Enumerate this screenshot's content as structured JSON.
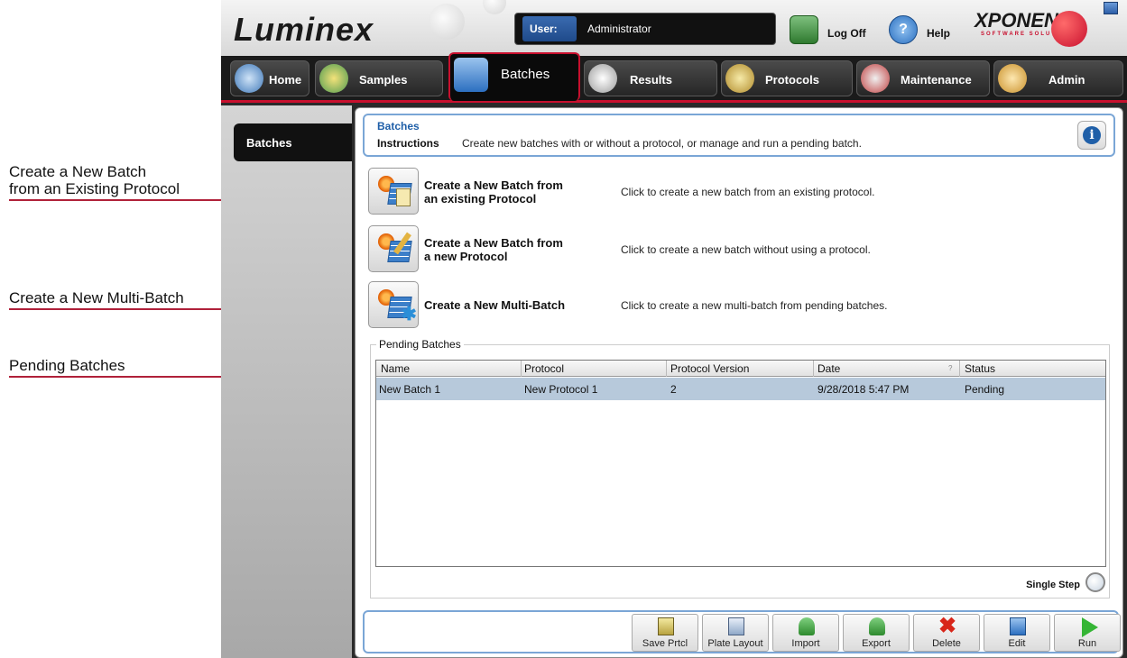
{
  "annotations": {
    "create_existing": "Create a New Batch\nfrom an Existing Protocol",
    "create_existing_line1": "Create a New Batch",
    "create_existing_line2": "from an Existing Protocol",
    "multi_batch": "Create a New Multi-Batch",
    "pending": "Pending Batches"
  },
  "topbar": {
    "logo": "Luminex",
    "user_label": "User:",
    "user_value": "Administrator",
    "logoff": "Log Off",
    "help": "Help",
    "brand": "XPONENT",
    "brand_sub": "SOFTWARE SOLUTIONS"
  },
  "nav": {
    "tabs": [
      {
        "label": "Home",
        "icon": "home-icon"
      },
      {
        "label": "Samples",
        "icon": "samples-icon"
      },
      {
        "label": "Batches",
        "icon": "batches-icon",
        "active": true
      },
      {
        "label": "Results",
        "icon": "results-icon"
      },
      {
        "label": "Protocols",
        "icon": "protocols-icon"
      },
      {
        "label": "Maintenance",
        "icon": "maintenance-icon"
      },
      {
        "label": "Admin",
        "icon": "admin-icon"
      }
    ]
  },
  "sidebar": {
    "items": [
      {
        "label": "Batches"
      }
    ]
  },
  "header": {
    "title": "Batches",
    "instructions_label": "Instructions",
    "instructions": "Create new batches with or without a protocol, or manage and run a pending batch."
  },
  "actions": [
    {
      "title_line1": "Create a New Batch from",
      "title_line2": "an existing Protocol",
      "desc": "Click to create a new batch from an existing protocol."
    },
    {
      "title_line1": "Create a New Batch from",
      "title_line2": "a new Protocol",
      "desc": "Click to create a new batch without using a protocol."
    },
    {
      "title_line1": "Create a New Multi-Batch",
      "title_line2": "",
      "desc": "Click to create a new multi-batch from pending batches."
    }
  ],
  "pending": {
    "legend": "Pending Batches",
    "columns": [
      "Name",
      "Protocol",
      "Protocol Version",
      "Date",
      "Status"
    ],
    "rows": [
      {
        "name": "New Batch 1",
        "protocol": "New Protocol 1",
        "version": "2",
        "date": "9/28/2018 5:47 PM",
        "status": "Pending"
      }
    ],
    "single_step": "Single Step"
  },
  "toolbar": {
    "buttons": [
      {
        "label": "Save Prtcl",
        "icon": "save-protocol-icon"
      },
      {
        "label": "Plate Layout",
        "icon": "plate-layout-icon"
      },
      {
        "label": "Import",
        "icon": "import-icon"
      },
      {
        "label": "Export",
        "icon": "export-icon"
      },
      {
        "label": "Delete",
        "icon": "delete-icon"
      },
      {
        "label": "Edit",
        "icon": "edit-icon"
      },
      {
        "label": "Run",
        "icon": "run-icon"
      }
    ]
  },
  "colors": {
    "accent_red": "#c8102e",
    "accent_blue": "#1f5fa8",
    "callout": "#b0213a",
    "selected_row": "#b7c9db"
  }
}
